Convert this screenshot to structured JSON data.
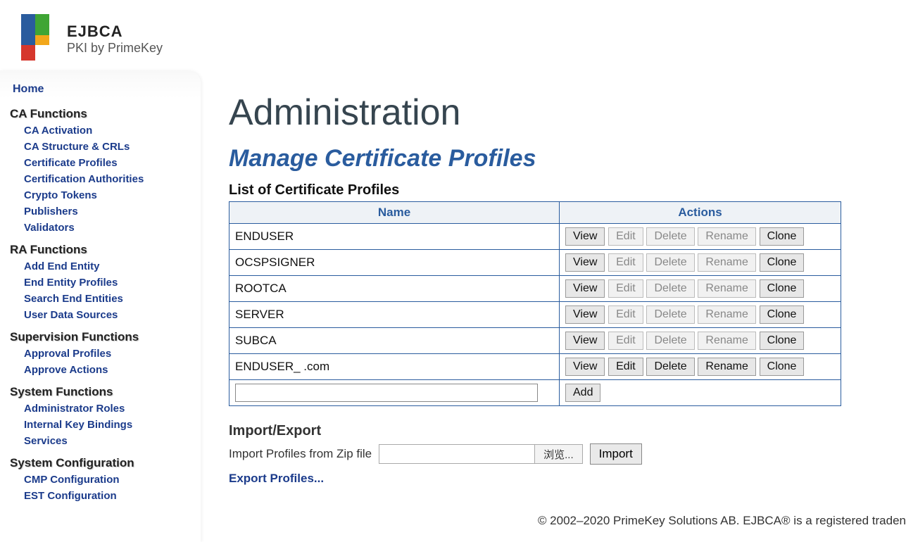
{
  "logo": {
    "title": "EJBCA",
    "subtitle": "PKI by PrimeKey"
  },
  "nav": {
    "home": "Home",
    "groups": [
      {
        "label": "CA Functions",
        "items": [
          "CA Activation",
          "CA Structure & CRLs",
          "Certificate Profiles",
          "Certification Authorities",
          "Crypto Tokens",
          "Publishers",
          "Validators"
        ]
      },
      {
        "label": "RA Functions",
        "items": [
          "Add End Entity",
          "End Entity Profiles",
          "Search End Entities",
          "User Data Sources"
        ]
      },
      {
        "label": "Supervision Functions",
        "items": [
          "Approval Profiles",
          "Approve Actions"
        ]
      },
      {
        "label": "System Functions",
        "items": [
          "Administrator Roles",
          "Internal Key Bindings",
          "Services"
        ]
      },
      {
        "label": "System Configuration",
        "items": [
          "CMP Configuration",
          "EST Configuration"
        ]
      }
    ]
  },
  "page": {
    "title": "Administration",
    "subtitle": "Manage Certificate Profiles",
    "list_heading": "List of Certificate Profiles",
    "columns": {
      "name": "Name",
      "actions": "Actions"
    },
    "rows": [
      {
        "name": "ENDUSER",
        "fixed": true
      },
      {
        "name": "OCSPSIGNER",
        "fixed": true
      },
      {
        "name": "ROOTCA",
        "fixed": true
      },
      {
        "name": "SERVER",
        "fixed": true
      },
      {
        "name": "SUBCA",
        "fixed": true
      },
      {
        "name": "ENDUSER_           .com",
        "fixed": false
      }
    ],
    "buttons": {
      "view": "View",
      "edit": "Edit",
      "delete": "Delete",
      "rename": "Rename",
      "clone": "Clone",
      "add": "Add"
    },
    "import_export": {
      "heading": "Import/Export",
      "import_label": "Import Profiles from Zip file",
      "browse": "浏览...",
      "import_btn": "Import",
      "export_link": "Export Profiles..."
    }
  },
  "footer": "© 2002–2020 PrimeKey Solutions AB. EJBCA® is a registered traden"
}
